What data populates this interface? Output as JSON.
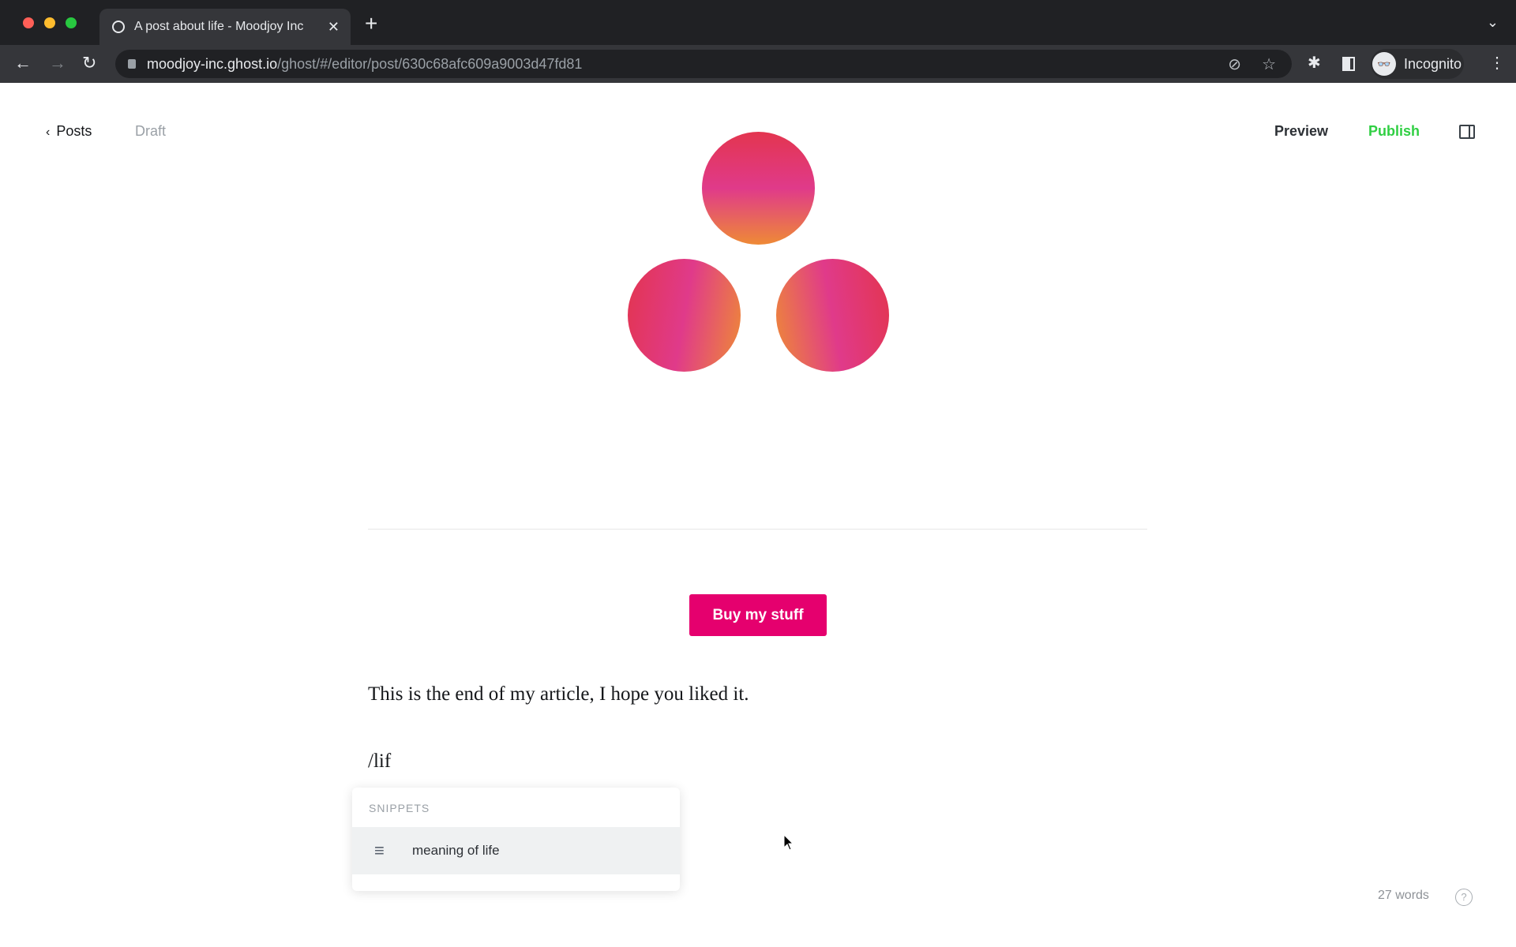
{
  "browser": {
    "tab_title": "A post about life - Moodjoy Inc",
    "url_host": "moodjoy-inc.ghost.io",
    "url_path": "/ghost/#/editor/post/630c68afc609a9003d47fd81",
    "profile_label": "Incognito"
  },
  "editor": {
    "back_label": "Posts",
    "status": "Draft",
    "preview_label": "Preview",
    "publish_label": "Publish",
    "publish_color": "#30cf43",
    "button_card_label": "Buy my stuff",
    "button_color": "#e5006e",
    "paragraph": "This is the end of my article, I hope you liked it.",
    "slash_input": "/lif",
    "word_count": "27 words"
  },
  "snippets_menu": {
    "heading": "SNIPPETS",
    "items": [
      {
        "label": "meaning of life",
        "icon": "snippet-icon"
      }
    ]
  }
}
